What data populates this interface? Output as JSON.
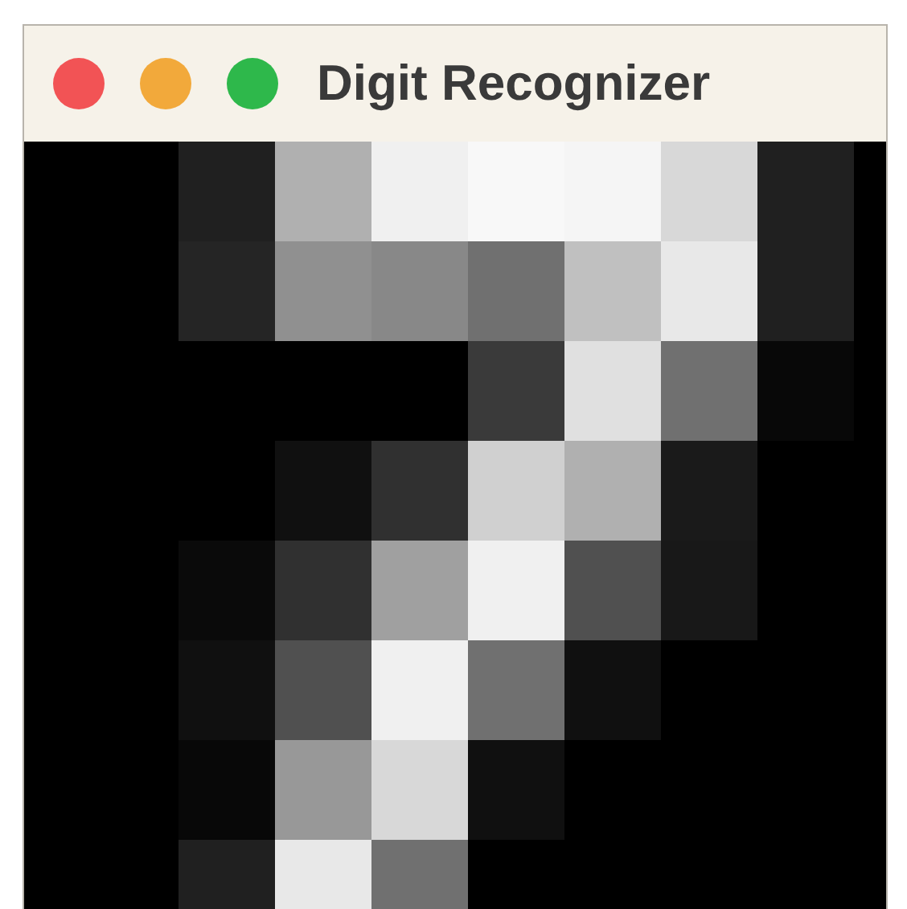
{
  "window": {
    "title": "Digit Recognizer"
  }
}
